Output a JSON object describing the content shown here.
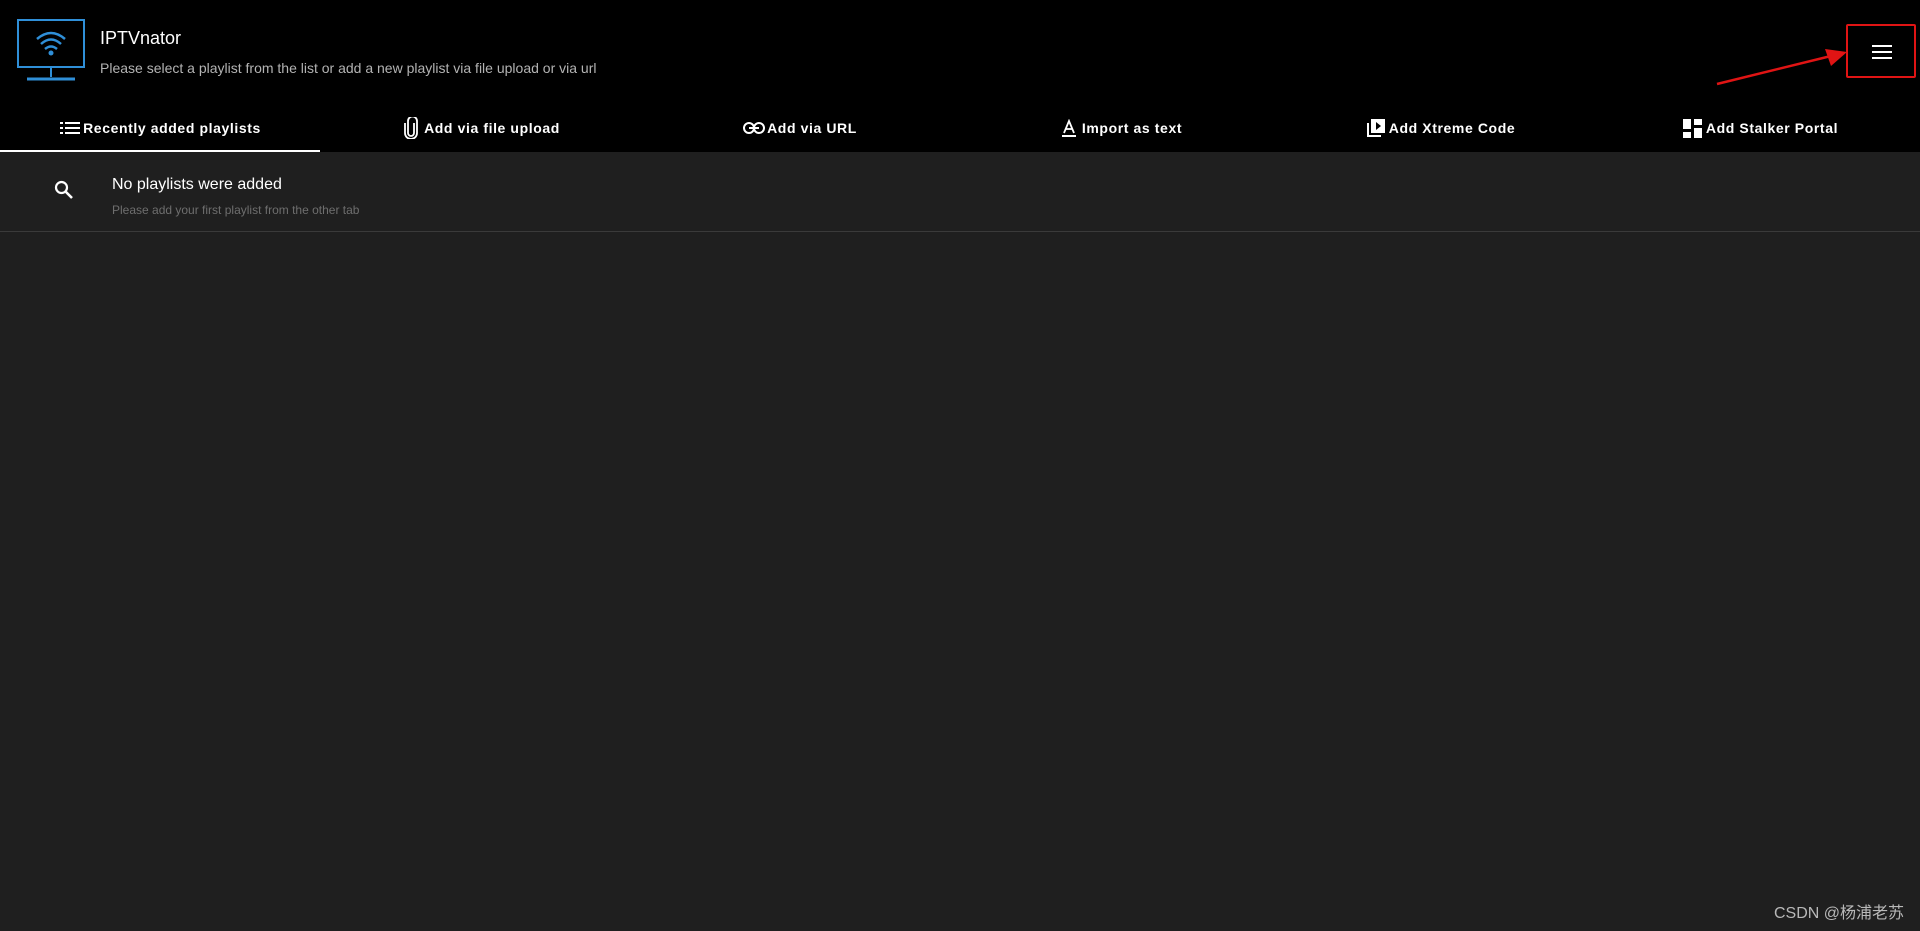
{
  "app": {
    "title": "IPTVnator",
    "subtitle": "Please select a playlist from the list or add a new playlist via file upload or via url",
    "logo_icon": "tv-wifi-icon",
    "menu_icon": "hamburger-menu-icon"
  },
  "tabs": [
    {
      "label": "Recently added playlists",
      "icon": "list-icon",
      "active": true
    },
    {
      "label": "Add via file upload",
      "icon": "paperclip-icon",
      "active": false
    },
    {
      "label": "Add via URL",
      "icon": "link-icon",
      "active": false
    },
    {
      "label": "Import as text",
      "icon": "text-format-icon",
      "active": false
    },
    {
      "label": "Add Xtreme Code",
      "icon": "video-library-icon",
      "active": false
    },
    {
      "label": "Add Stalker Portal",
      "icon": "dashboard-icon",
      "active": false
    }
  ],
  "empty_state": {
    "icon": "search-icon",
    "title": "No playlists were added",
    "subtitle": "Please add your first playlist from the other tab"
  },
  "watermark": "CSDN @杨浦老苏",
  "colors": {
    "header_bg": "#000000",
    "content_bg": "#1f1f1f",
    "logo_blue": "#2f8fd8",
    "annotation_red": "#e01414"
  }
}
